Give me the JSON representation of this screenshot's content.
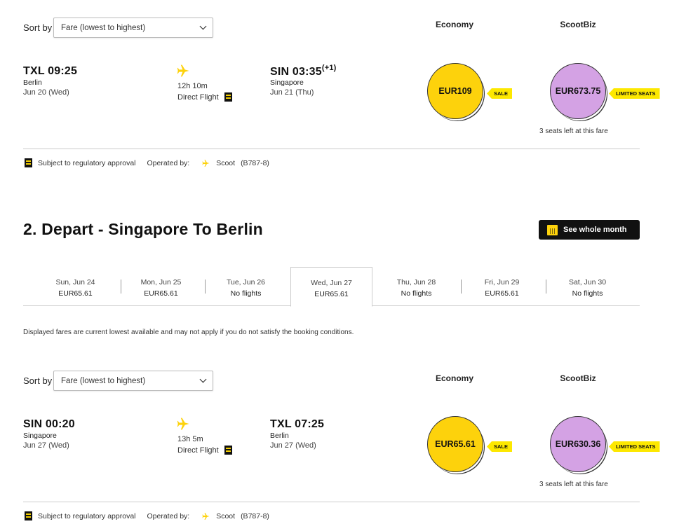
{
  "sort": {
    "label": "Sort by",
    "value": "Fare (lowest to highest)"
  },
  "columns": {
    "economy": "Economy",
    "scootbiz": "ScootBiz"
  },
  "flight1": {
    "dep_time": "TXL 09:25",
    "dep_city": "Berlin",
    "dep_date": "Jun 20 (Wed)",
    "duration": "12h 10m",
    "direct": "Direct Flight",
    "arr_time": "SIN 03:35",
    "arr_plus": "(+1)",
    "arr_city": "Singapore",
    "arr_date": "Jun 21 (Thu)",
    "eco_price": "EUR109",
    "eco_tag": "SALE",
    "biz_price": "EUR673.75",
    "biz_tag": "LIMITED SEATS",
    "seats_left": "3 seats left at this fare",
    "regulatory": "Subject to regulatory approval",
    "operated_label": "Operated by:",
    "operator": "Scoot",
    "aircraft": "(B787-8)"
  },
  "section2": {
    "title": "2. Depart - Singapore To Berlin",
    "month_button": "See whole month"
  },
  "date_tabs": [
    {
      "label": "Sun, Jun 24",
      "value": "EUR65.61"
    },
    {
      "label": "Mon, Jun 25",
      "value": "EUR65.61"
    },
    {
      "label": "Tue, Jun 26",
      "value": "No flights"
    },
    {
      "label": "Wed, Jun 27",
      "value": "EUR65.61"
    },
    {
      "label": "Thu, Jun 28",
      "value": "No flights"
    },
    {
      "label": "Fri, Jun 29",
      "value": "EUR65.61"
    },
    {
      "label": "Sat, Jun 30",
      "value": "No flights"
    }
  ],
  "disclaimer": "Displayed fares are current lowest available and may not apply if you do not satisfy the booking conditions.",
  "flight2": {
    "dep_time": "SIN 00:20",
    "dep_city": "Singapore",
    "dep_date": "Jun 27 (Wed)",
    "duration": "13h 5m",
    "direct": "Direct Flight",
    "arr_time": "TXL 07:25",
    "arr_city": "Berlin",
    "arr_date": "Jun 27 (Wed)",
    "eco_price": "EUR65.61",
    "eco_tag": "SALE",
    "biz_price": "EUR630.36",
    "biz_tag": "LIMITED SEATS",
    "seats_left": "3 seats left at this fare",
    "regulatory": "Subject to regulatory approval",
    "operated_label": "Operated by:",
    "operator": "Scoot",
    "aircraft": "(B787-8)"
  },
  "colors": {
    "economy": "#fdd20c",
    "scootbiz": "#d4a2e4",
    "tag": "#fde800",
    "button": "#111111"
  }
}
